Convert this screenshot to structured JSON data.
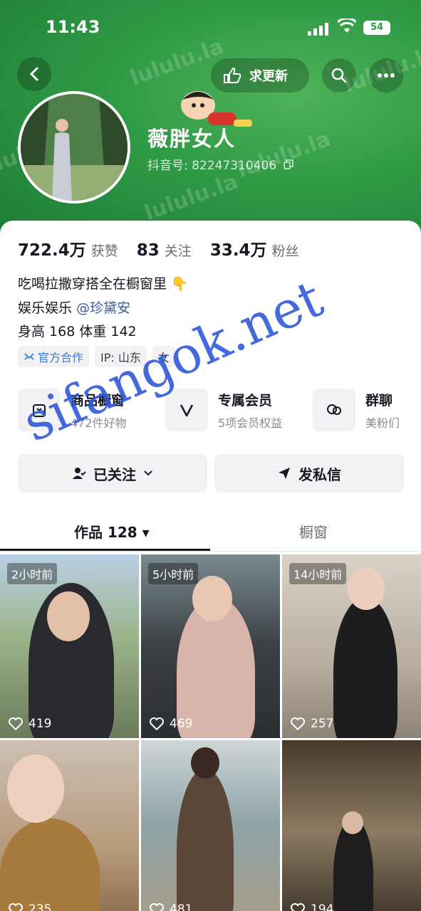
{
  "status_bar": {
    "time": "11:43",
    "battery": "54"
  },
  "header": {
    "update_label": "求更新",
    "name": "薇胖女人",
    "douyin_id": "抖音号: 82247310406"
  },
  "stats": [
    {
      "value": "722.4万",
      "label": "获赞"
    },
    {
      "value": "83",
      "label": "关注"
    },
    {
      "value": "33.4万",
      "label": "粉丝"
    }
  ],
  "bio": {
    "line1": "吃喝拉撒穿搭全在橱窗里 👇",
    "line2_prefix": "娱乐娱乐",
    "mention": "@珍黛安",
    "line3": "身高 168 体重 142"
  },
  "tags": {
    "official": "官方合作",
    "ip": "IP: 山东",
    "gender": "女"
  },
  "features": [
    {
      "title": "商品橱窗",
      "sub": "472件好物"
    },
    {
      "title": "专属会员",
      "sub": "5项会员权益"
    },
    {
      "title": "群聊",
      "sub": "美粉们"
    }
  ],
  "actions": {
    "follow": "已关注",
    "message": "发私信"
  },
  "tabs": {
    "works": "作品 128 ▾",
    "shop": "橱窗"
  },
  "videos": [
    {
      "time": "2小时前",
      "likes": "419"
    },
    {
      "time": "5小时前",
      "likes": "469"
    },
    {
      "time": "14小时前",
      "likes": "257"
    },
    {
      "time": "",
      "likes": "235"
    },
    {
      "time": "",
      "likes": "481"
    },
    {
      "time": "",
      "likes": "194"
    }
  ],
  "watermark": {
    "overlay": "sifangok.net",
    "tile": "lululu.la"
  },
  "colors": {
    "header_green": "#2f9a45",
    "mention_blue": "#3b5aa8",
    "watermark_blue": "#2a55d9"
  }
}
